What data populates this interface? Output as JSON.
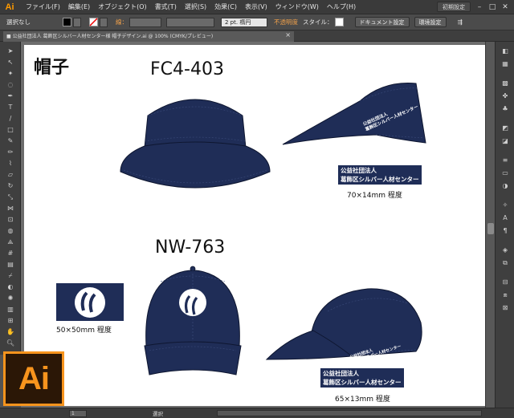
{
  "app": {
    "logo": "Ai",
    "menu": [
      "ファイル(F)",
      "編集(E)",
      "オブジェクト(O)",
      "書式(T)",
      "選択(S)",
      "効果(C)",
      "表示(V)",
      "ウィンドウ(W)",
      "ヘルプ(H)"
    ],
    "workspace": "初期設定"
  },
  "control": {
    "selection": "選択なし",
    "stroke_label": "線：",
    "stroke_weight": "2 pt. 楕円",
    "opacity_label": "不透明度",
    "style_label": "スタイル：",
    "doc_settings": "ドキュメント設定",
    "prefs": "環境設定"
  },
  "document": {
    "tab_title": "■ 公益社団法人 葛飾区シルバー人材センター様 帽子デザイン.ai @ 100% (CMYK/プレビュー)"
  },
  "status": {
    "zoom": "1",
    "mode": "選択"
  },
  "artwork": {
    "title": "帽子",
    "visor_model": "FC4-403",
    "cap_model": "NW-763",
    "patch_line1": "公益社団法人",
    "patch_line2": "葛飾区シルバー人材センター",
    "visor_size": "70×14mm 程度",
    "logo_size": "50×50mm 程度",
    "cap_size": "65×13mm 程度",
    "colors": {
      "navy": "#1f2d57",
      "orange": "#f7941d"
    }
  }
}
